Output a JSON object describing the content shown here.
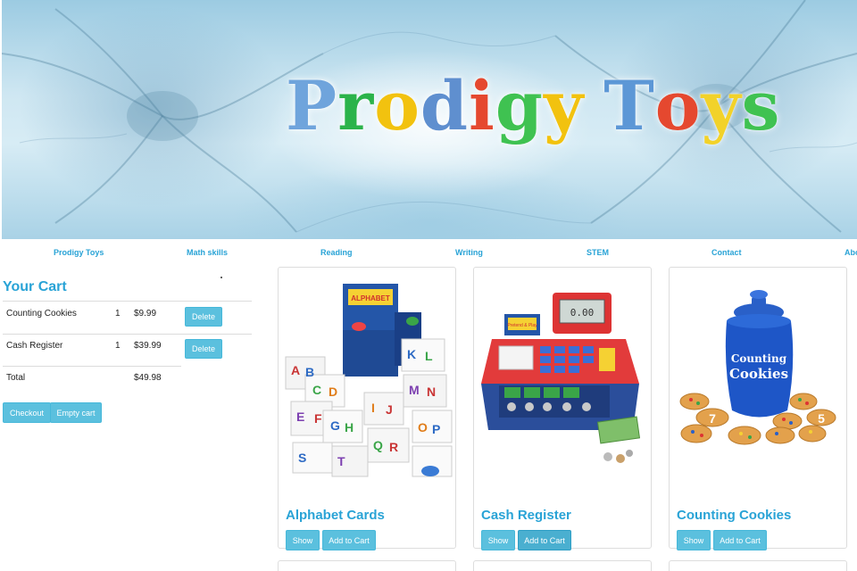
{
  "banner": {
    "title_letters": [
      {
        "ch": "P",
        "color": "#6fa4dc"
      },
      {
        "ch": "r",
        "color": "#2bb34a"
      },
      {
        "ch": "o",
        "color": "#f2c20f"
      },
      {
        "ch": "d",
        "color": "#5f8fcf"
      },
      {
        "ch": "i",
        "color": "#e5482f"
      },
      {
        "ch": "g",
        "color": "#3fc251"
      },
      {
        "ch": "y",
        "color": "#f2c20f"
      },
      {
        "ch": " ",
        "color": "#000000"
      },
      {
        "ch": "T",
        "color": "#5c97d6"
      },
      {
        "ch": "o",
        "color": "#e5482f"
      },
      {
        "ch": "y",
        "color": "#f2d22a"
      },
      {
        "ch": "s",
        "color": "#3fc251"
      }
    ]
  },
  "nav": {
    "items": [
      "Prodigy Toys",
      "Math skills",
      "Reading",
      "Writing",
      "STEM",
      "Contact",
      "Abo"
    ]
  },
  "cart": {
    "title": "Your Cart",
    "items": [
      {
        "name": "Counting Cookies",
        "qty": "1",
        "price": "$9.99",
        "action": "Delete"
      },
      {
        "name": "Cash Register",
        "qty": "1",
        "price": "$39.99",
        "action": "Delete"
      }
    ],
    "total_label": "Total",
    "total_value": "$49.98",
    "checkout_label": "Checkout",
    "empty_label": "Empty cart"
  },
  "products": [
    {
      "name": "Alphabet Cards",
      "show_label": "Show",
      "add_label": "Add to Cart"
    },
    {
      "name": "Cash Register",
      "show_label": "Show",
      "add_label": "Add to Cart"
    },
    {
      "name": "Counting Cookies",
      "show_label": "Show",
      "add_label": "Add to Cart"
    }
  ],
  "product_images": {
    "alphabet_box_label": "ALPHABET",
    "letters": [
      "A",
      "B",
      "C",
      "D",
      "E",
      "F",
      "G",
      "H",
      "I",
      "J",
      "K",
      "L",
      "M",
      "N",
      "O",
      "P",
      "Q",
      "R",
      "S",
      "T"
    ],
    "register_display": "0.00",
    "register_brand": "Pretend & Play",
    "cookies_jar_label_1": "Counting",
    "cookies_jar_label_2": "Cookies",
    "cookie_numbers": [
      "7",
      "5"
    ]
  },
  "colors": {
    "accent": "#29a3d6",
    "button": "#5bc0de",
    "border": "#dddddd"
  }
}
